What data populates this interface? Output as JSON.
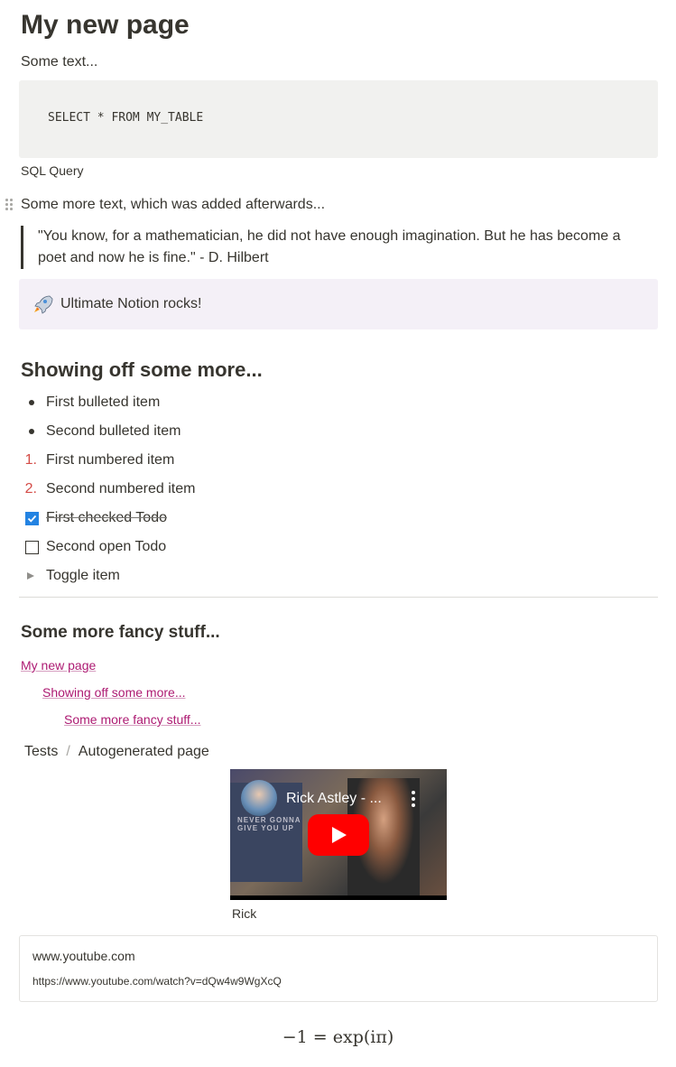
{
  "page": {
    "title": "My new page",
    "intro_text": "Some text...",
    "code": {
      "content": "SELECT * FROM MY_TABLE",
      "caption": "SQL Query"
    },
    "after_text": "Some more text, which was added afterwards...",
    "quote": "\"You know, for a mathematician, he did not have enough imagination. But he has become a poet and now he is fine.\" - D. Hilbert",
    "callout": {
      "icon": "rocket-icon",
      "text": "Ultimate Notion rocks!",
      "background": "#f4f0f7"
    },
    "section1": {
      "heading": "Showing off some more...",
      "bulleted": [
        "First bulleted item",
        "Second bulleted item"
      ],
      "numbered": [
        {
          "number": "1.",
          "text": "First numbered item"
        },
        {
          "number": "2.",
          "text": "Second numbered item"
        }
      ],
      "todos": [
        {
          "text": "First checked Todo",
          "checked": true
        },
        {
          "text": "Second open Todo",
          "checked": false
        }
      ],
      "toggle": "Toggle item"
    },
    "section2": {
      "heading": "Some more fancy stuff...",
      "toc": [
        "My new page",
        "Showing off some more...",
        "Some more fancy stuff..."
      ],
      "breadcrumb": [
        "Tests",
        "Autogenerated page"
      ],
      "breadcrumb_separator": "/"
    },
    "video": {
      "title": "Rick Astley - ...",
      "caption": "Rick",
      "frame_text": "NEVER GONNA\nGIVE YOU UP"
    },
    "bookmark": {
      "title": "www.youtube.com",
      "url": "https://www.youtube.com/watch?v=dQw4w9WgXcQ"
    },
    "equation": "−1 = exp(iπ)"
  },
  "colors": {
    "text": "#37352f",
    "numbered_marker": "#d44c47",
    "link": "#ad1a72",
    "checkbox_checked": "#2383e2",
    "code_background": "#f1f1ef"
  }
}
